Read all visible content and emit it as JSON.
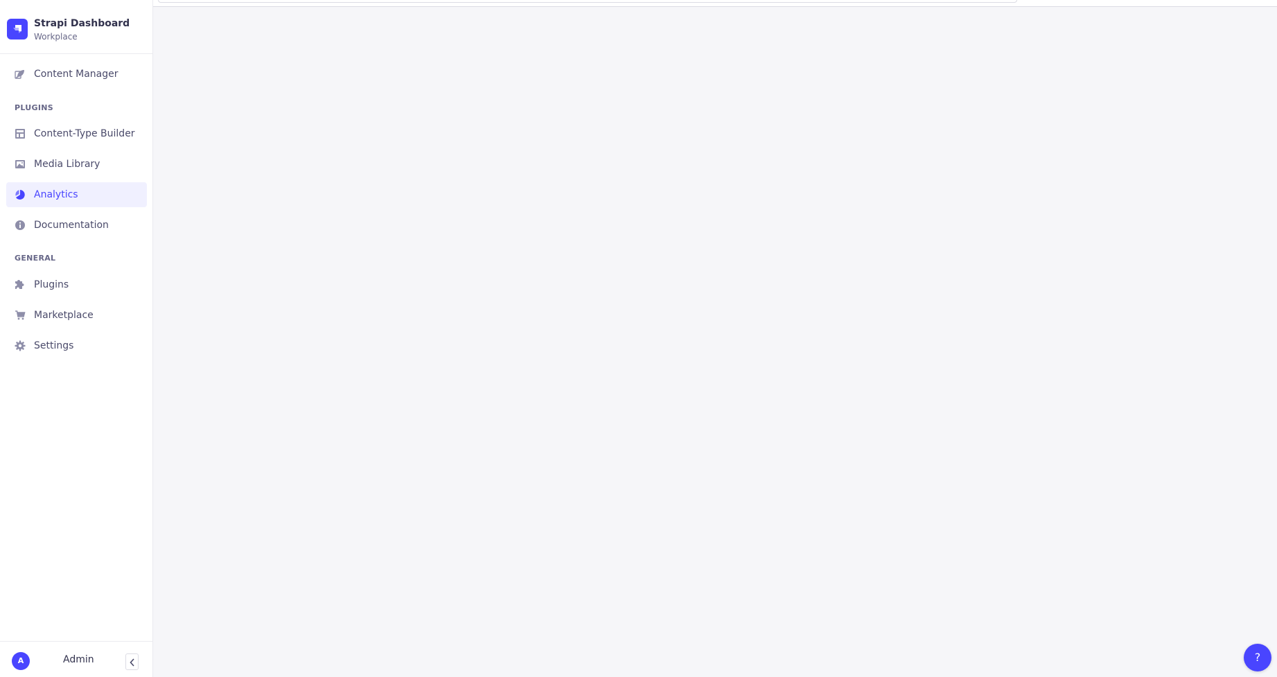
{
  "brand": {
    "title": "Strapi Dashboard",
    "subtitle": "Workplace",
    "logo_icon": "strapi-logo-icon"
  },
  "sidebar": {
    "items": [
      {
        "label": "Content Manager",
        "icon": "feather-icon"
      },
      {
        "label": "Content-Type Builder",
        "icon": "layout-icon"
      },
      {
        "label": "Media Library",
        "icon": "image-icon"
      },
      {
        "label": "Analytics",
        "icon": "analytics-icon",
        "active": true
      },
      {
        "label": "Documentation",
        "icon": "info-icon"
      },
      {
        "label": "Plugins",
        "icon": "puzzle-icon"
      },
      {
        "label": "Marketplace",
        "icon": "cart-icon"
      },
      {
        "label": "Settings",
        "icon": "gear-icon"
      }
    ],
    "sections": {
      "plugins": "PLUGINS",
      "general": "GENERAL"
    }
  },
  "footer": {
    "avatar_initial": "A",
    "user_name": "Admin"
  },
  "help": {
    "label": "?"
  },
  "colors": {
    "primary": "#4945ff",
    "sidebar_active_bg": "#f0f0ff",
    "page_bg": "#f6f6f9"
  }
}
